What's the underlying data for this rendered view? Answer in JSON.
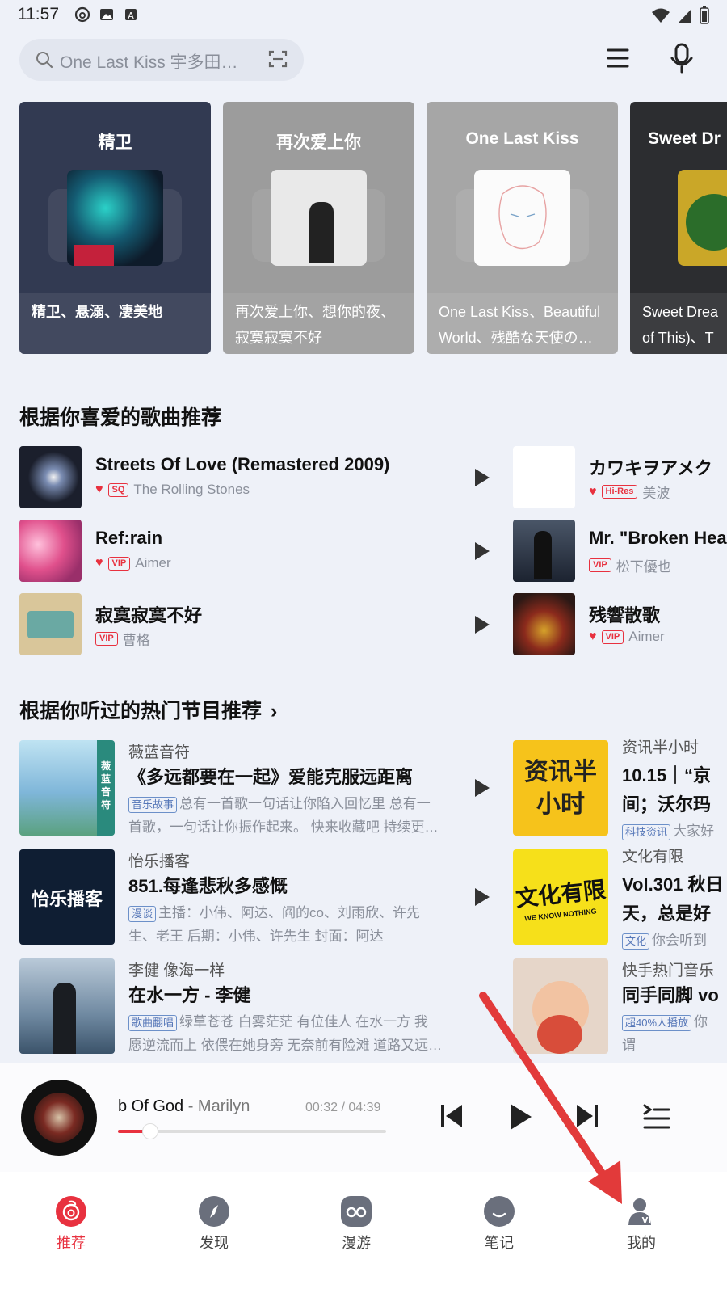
{
  "status_bar": {
    "time": "11:57"
  },
  "search": {
    "placeholder": "One Last Kiss 宇多田…"
  },
  "cards": [
    {
      "title": "精卫",
      "sub_line1": "精卫、悬溺、凄美地",
      "sub_line2": ""
    },
    {
      "title": "再次爱上你",
      "sub_line1": "再次爱上你、想你的夜、",
      "sub_line2": "寂寞寂寞不好"
    },
    {
      "title": "One Last Kiss",
      "sub_line1": "One Last Kiss、Beautiful",
      "sub_line2": "World、残酷な天使のテ…"
    },
    {
      "title": "Sweet Dr",
      "sub_line1": "Sweet Drea",
      "sub_line2": "of This)、T"
    }
  ],
  "songs_section": {
    "title": "根据你喜爱的歌曲推荐"
  },
  "songs_left": [
    {
      "title": "Streets Of Love (Remastered 2009)",
      "tag": "SQ",
      "artist": "The Rolling Stones"
    },
    {
      "title": "Ref:rain",
      "tag": "VIP",
      "artist": "Aimer"
    },
    {
      "title": "寂寞寂寞不好",
      "tag": "VIP",
      "artist": "曹格"
    }
  ],
  "songs_right": [
    {
      "title": "カワキヲアメク",
      "tag": "Hi-Res",
      "artist": "美波"
    },
    {
      "title": "Mr. \"Broken Hea",
      "tag": "VIP",
      "artist": "松下優也"
    },
    {
      "title": "残響散歌",
      "tag": "VIP",
      "artist": "Aimer"
    }
  ],
  "podcast_section": {
    "title": "根据你听过的热门节目推荐",
    "chevron": "›"
  },
  "podcasts_left": [
    {
      "author": "薇蓝音符",
      "title": "《多远都要在一起》爱能克服远距离",
      "tag": "音乐故事",
      "desc1": "总有一首歌一句话让你陷入回忆里 总有一",
      "desc2": "首歌，一句话让你振作起来。 快来收藏吧 持续更…",
      "cover_text": "薇蓝音符"
    },
    {
      "author": "怡乐播客",
      "title": "851.每逢悲秋多感慨",
      "tag": "漫谈",
      "desc1": "主播：小伟、阿达、阎的co、刘雨欣、许先",
      "desc2": "生、老王 后期：小伟、许先生 封面：阿达",
      "cover_text": "怡乐播客"
    },
    {
      "author": "李健 像海一样",
      "title": "在水一方 - 李健",
      "tag": "歌曲翻唱",
      "desc1": "绿草苍苍 白雾茫茫 有位佳人 在水一方 我",
      "desc2": "愿逆流而上 依偎在她身旁 无奈前有险滩 道路又远…",
      "cover_text": ""
    }
  ],
  "podcasts_right": [
    {
      "author": "资讯半小时",
      "title_line1": "10.15｜“京",
      "title_line2": "间；沃尔玛",
      "tag": "科技资讯",
      "desc1": "大家好",
      "cover_text_1": "资讯半",
      "cover_text_2": "小时"
    },
    {
      "author": "文化有限",
      "title_line1": "Vol.301 秋日",
      "title_line2": "天，总是好",
      "tag": "文化",
      "desc1": "你会听到",
      "cover_text_1": "文化有限",
      "cover_text_2": "WE KNOW NOTHING"
    },
    {
      "author": "快手热门音乐",
      "title_line1": "同手同脚 vo",
      "title_line2": "",
      "tag": "超40%人播放",
      "desc1": "你",
      "desc2": "谓",
      "cover_text_1": "",
      "cover_text_2": ""
    }
  ],
  "player": {
    "song": "b Of God",
    "artist": " - Marilyn I",
    "time": "00:32 / 04:39",
    "progress": 0.12
  },
  "tabs": [
    {
      "label": "推荐",
      "icon": "netease-logo-icon"
    },
    {
      "label": "发现",
      "icon": "compass-icon"
    },
    {
      "label": "漫游",
      "icon": "roam-icon"
    },
    {
      "label": "笔记",
      "icon": "notes-icon"
    },
    {
      "label": "我的",
      "icon": "user-vip-icon"
    }
  ],
  "colors": {
    "accent": "#e8313f",
    "background": "#eef1f8",
    "tag_blue": "#5677b8"
  }
}
